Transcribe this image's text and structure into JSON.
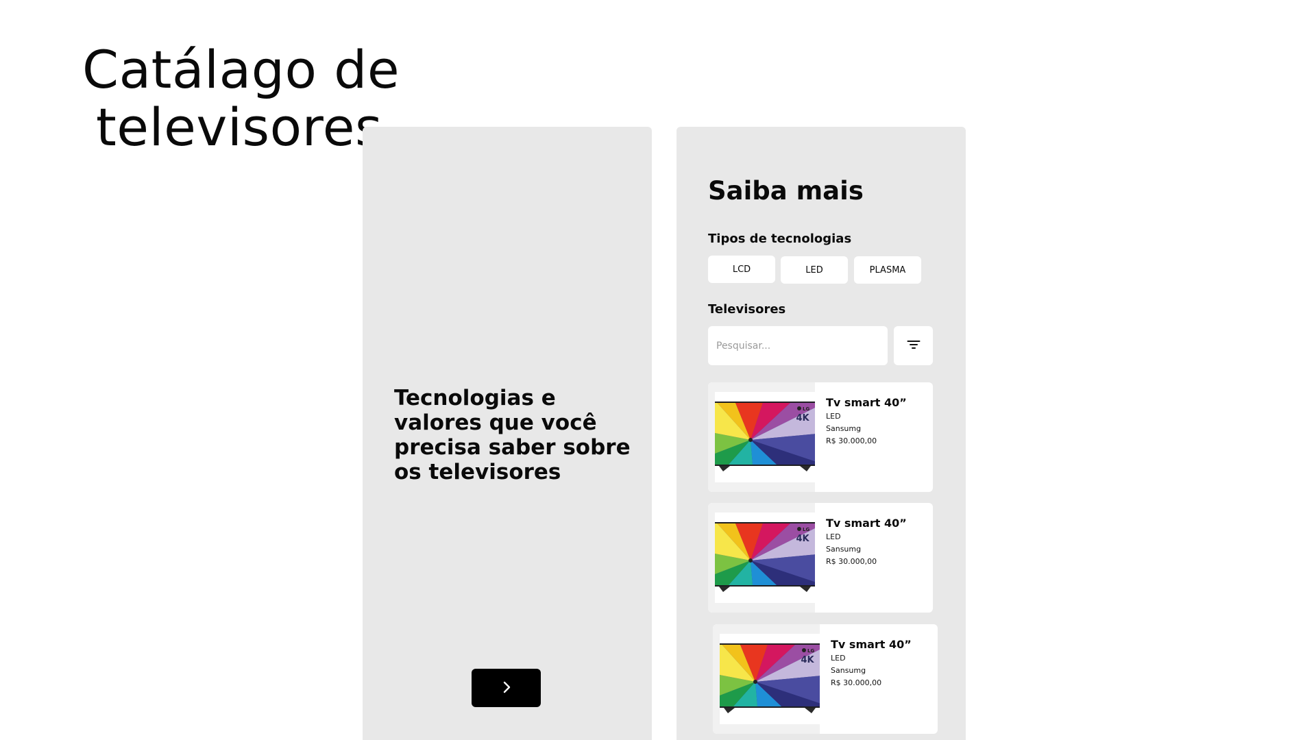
{
  "page": {
    "title_line1": "Catálago de",
    "title_line2": "televisores"
  },
  "intro_screen": {
    "heading": "Tecnologias e valores que você precisa saber sobre os televisores",
    "next_icon": "chevron-right-icon"
  },
  "detail_screen": {
    "title": "Saiba mais",
    "technologies_label": "Tipos de tecnologias",
    "technologies": [
      "LCD",
      "LED",
      "PLASMA"
    ],
    "televisions_label": "Televisores",
    "search": {
      "placeholder": "Pesquisar...",
      "value": ""
    },
    "filter_icon": "filter-icon",
    "products": [
      {
        "name": "Tv smart 40”",
        "technology": "LED",
        "brand": "Sansumg",
        "price": "R$ 30.000,00",
        "screen_text": "4K"
      },
      {
        "name": "Tv smart 40”",
        "technology": "LED",
        "brand": "Sansumg",
        "price": "R$ 30.000,00",
        "screen_text": "4K"
      },
      {
        "name": "Tv smart 40”",
        "technology": "LED",
        "brand": "Sansumg",
        "price": "R$ 30.000,00",
        "screen_text": "4K"
      }
    ]
  },
  "colors": {
    "page_background": "#ffffff",
    "screen_background": "#e8e8e8",
    "card_background": "#ffffff",
    "button_dark": "#000000",
    "text": "#0a0a0a"
  }
}
